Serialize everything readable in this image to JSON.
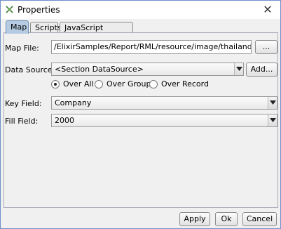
{
  "window": {
    "title": "Properties",
    "close_glyph": "✕"
  },
  "tabs": [
    {
      "label": "Map",
      "active": true
    },
    {
      "label": "Scripts",
      "active": false
    },
    {
      "label": "JavaScript Graphics",
      "active": false
    }
  ],
  "form": {
    "map_file_label": "Map File:",
    "map_file_value": "/ElixirSamples/Report/RML/resource/image/thailand.map",
    "browse_label": "...",
    "data_source_label": "Data Source:",
    "data_source_value": "<Section DataSource>",
    "add_label": "Add...",
    "radios": [
      {
        "label": "Over All",
        "selected": true
      },
      {
        "label": "Over Group",
        "selected": false
      },
      {
        "label": "Over Record",
        "selected": false
      }
    ],
    "key_field_label": "Key Field:",
    "key_field_value": "Company",
    "fill_field_label": "Fill Field:",
    "fill_field_value": "2000"
  },
  "buttons": {
    "apply": "Apply",
    "ok": "Ok",
    "cancel": "Cancel"
  },
  "colors": {
    "active_tab": "#b5cbe2",
    "window_border": "#6d8fc7"
  },
  "icons": {
    "app": "properties-app-icon",
    "close": "close-icon",
    "dropdown": "chevron-down-icon"
  }
}
